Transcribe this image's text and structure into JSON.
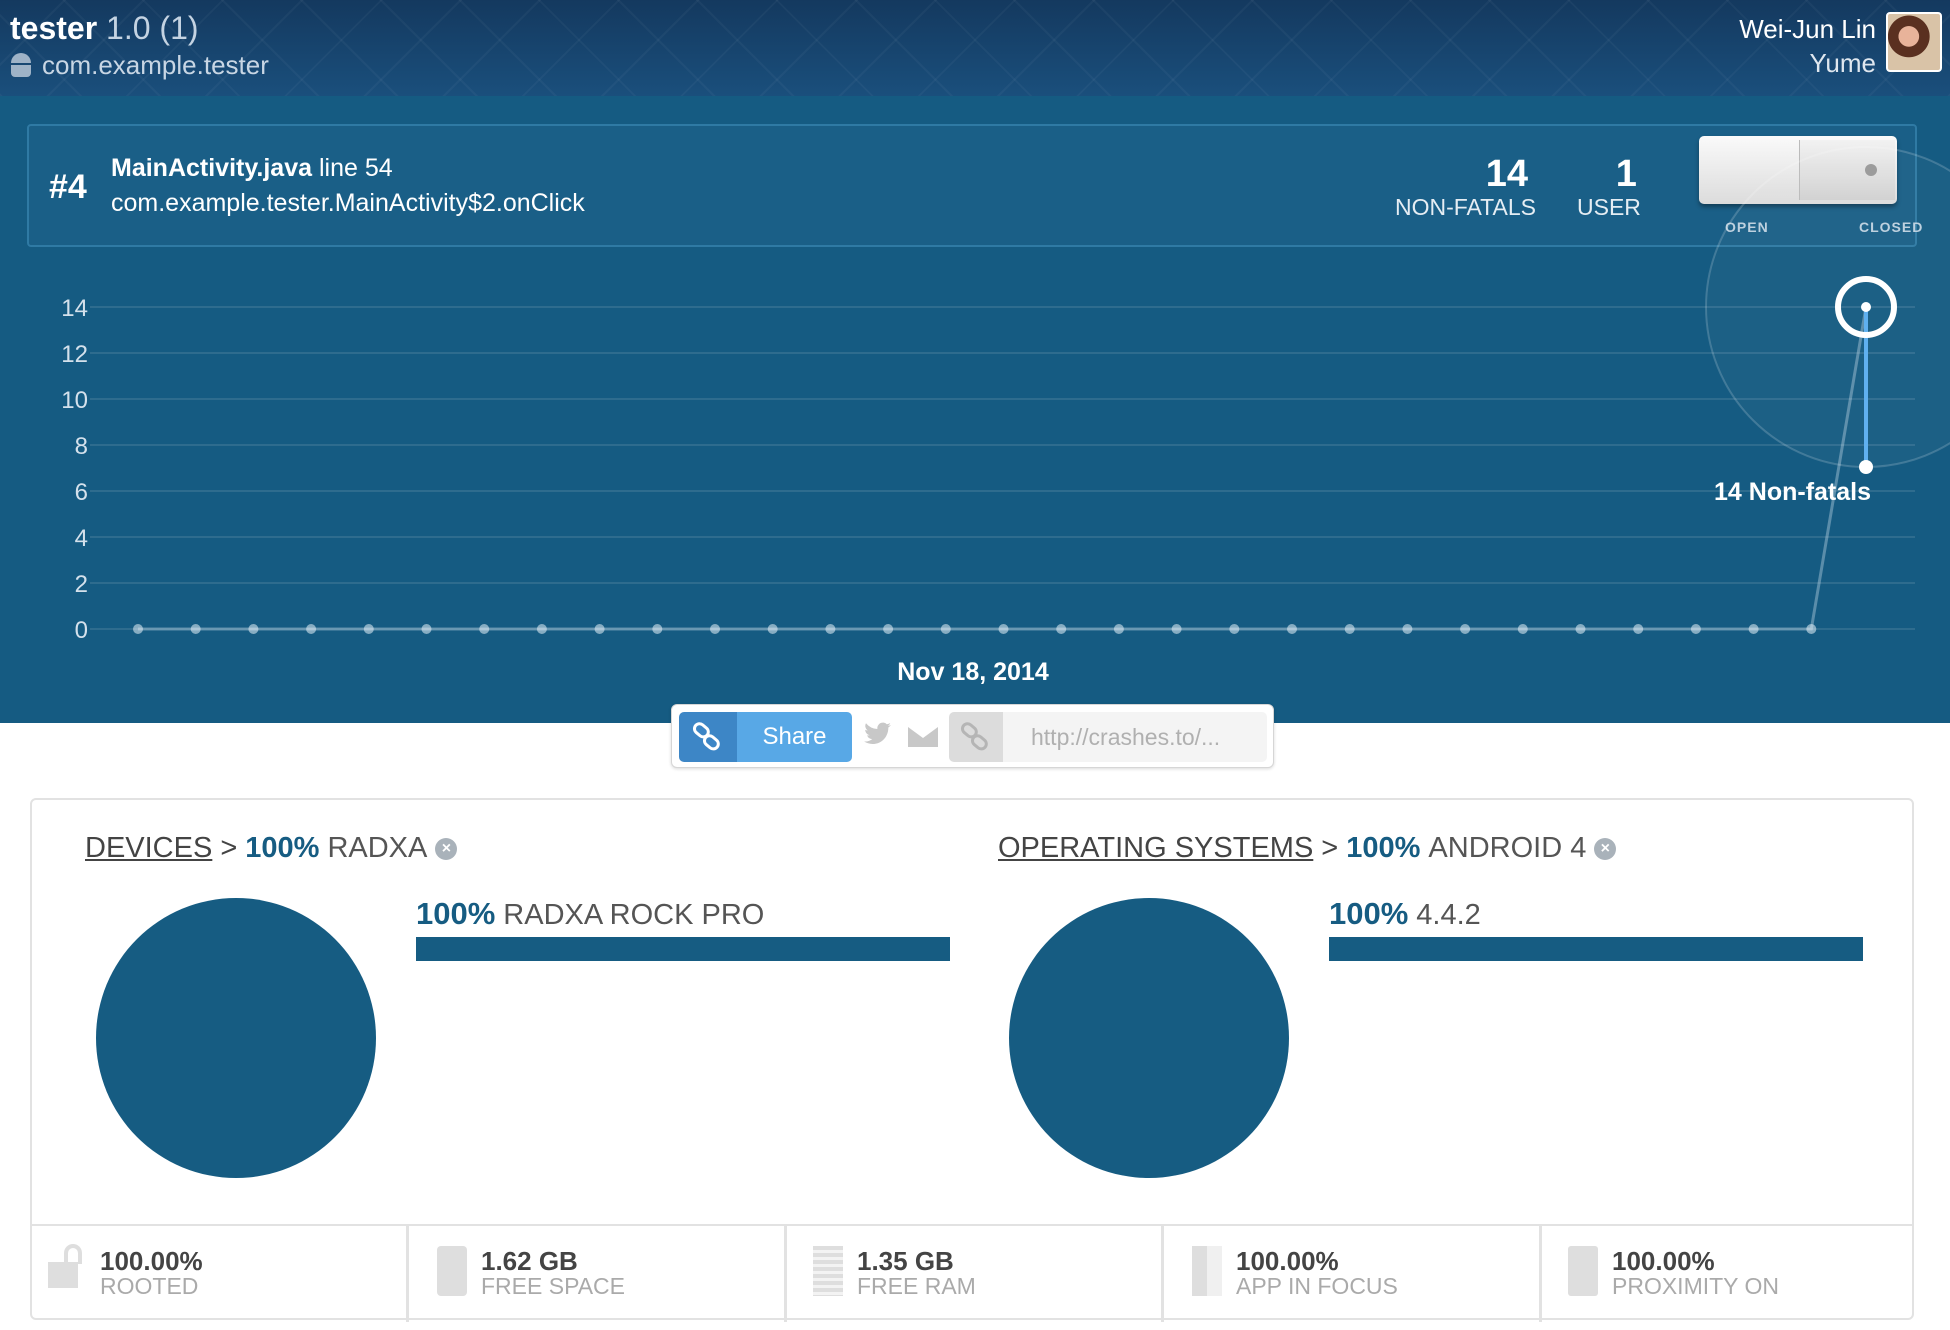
{
  "header": {
    "app_name": "tester",
    "version": "1.0 (1)",
    "package": "com.example.tester",
    "user_name": "Wei-Jun Lin",
    "org_name": "Yume"
  },
  "issue": {
    "number": "#4",
    "file": "MainActivity.java",
    "line": "line 54",
    "method": "com.example.tester.MainActivity$2.onClick",
    "non_fatals_count": "14",
    "non_fatals_label": "NON-FATALS",
    "users_count": "1",
    "users_label": "USER",
    "toggle_open_label": "OPEN",
    "toggle_closed_label": "CLOSED",
    "toggle_state": "closed"
  },
  "chart_data": {
    "type": "line",
    "x_label": "Nov 18, 2014",
    "y_ticks": [
      0,
      2,
      4,
      6,
      8,
      10,
      12,
      14
    ],
    "ylim": [
      0,
      14
    ],
    "values": [
      0,
      0,
      0,
      0,
      0,
      0,
      0,
      0,
      0,
      0,
      0,
      0,
      0,
      0,
      0,
      0,
      0,
      0,
      0,
      0,
      0,
      0,
      0,
      0,
      0,
      0,
      0,
      0,
      0,
      0,
      14
    ],
    "tooltip": "14 Non-fatals",
    "grid": true
  },
  "share": {
    "button_label": "Share",
    "url_placeholder": "http://crashes.to/..."
  },
  "devices": {
    "crumb_link": "DEVICES",
    "crumb_sep": ">",
    "crumb_pct": "100%",
    "crumb_value": "RADXA",
    "bar_pct": "100%",
    "bar_name": "RADXA ROCK PRO",
    "bar_fraction": 1.0
  },
  "os": {
    "crumb_link": "OPERATING SYSTEMS",
    "crumb_sep": ">",
    "crumb_pct": "100%",
    "crumb_value": "ANDROID 4",
    "bar_pct": "100%",
    "bar_name": "4.4.2",
    "bar_fraction": 1.0
  },
  "stats": [
    {
      "value": "100.00%",
      "caption": "ROOTED",
      "icon": "lock-icon"
    },
    {
      "value": "1.62 GB",
      "caption": "FREE SPACE",
      "icon": "disk-icon"
    },
    {
      "value": "1.35 GB",
      "caption": "FREE RAM",
      "icon": "ram-icon"
    },
    {
      "value": "100.00%",
      "caption": "APP IN FOCUS",
      "icon": "focus-icon"
    },
    {
      "value": "100.00%",
      "caption": "PROXIMITY ON",
      "icon": "proximity-icon"
    }
  ],
  "colors": {
    "accent": "#165c82",
    "header_bg": "#14395f",
    "share_blue": "#58a8e6"
  }
}
